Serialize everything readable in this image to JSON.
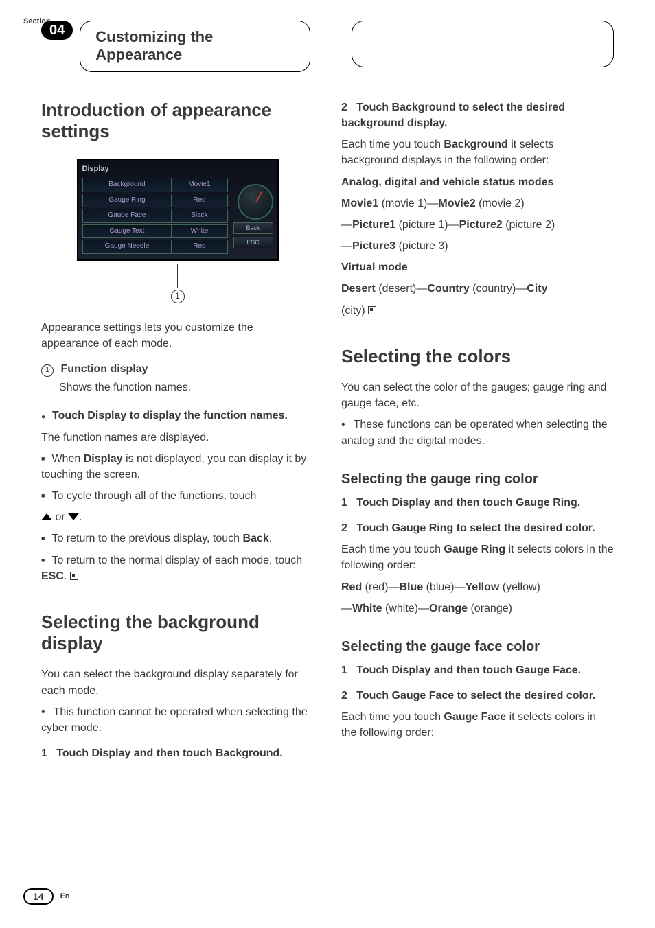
{
  "header": {
    "section_label": "Section",
    "section_number": "04",
    "section_title": "Customizing the Appearance"
  },
  "left_col": {
    "intro": {
      "heading": "Introduction of appearance settings",
      "screenshot": {
        "window_title": "Display",
        "items": [
          {
            "label": "Background",
            "value": "Movie1"
          },
          {
            "label": "Gauge Ring",
            "value": "Red"
          },
          {
            "label": "Gauge Face",
            "value": "Black"
          },
          {
            "label": "Gauge Text",
            "value": "White"
          },
          {
            "label": "Gauge Needle",
            "value": "Red"
          }
        ],
        "side_buttons": [
          "Back",
          "ESC"
        ],
        "callout_number": "1"
      },
      "lead": "Appearance settings lets you customize the appearance of each mode.",
      "func": {
        "num": "1",
        "title": "Function display",
        "desc": "Shows the function names."
      },
      "step_dot": {
        "bold": "Touch Display to display the function names.",
        "plain": "The function names are displayed."
      },
      "notes": {
        "n1a": "When ",
        "n1b": "Display",
        "n1c": " is not displayed, you can display it by touching the screen.",
        "n2": "To cycle through all of the functions, touch",
        "n2b": " or ",
        "n2c": ".",
        "n3a": "To return to the previous display, touch ",
        "n3b": "Back",
        "n3c": ".",
        "n4a": "To return to the normal display of each mode, touch ",
        "n4b": "ESC",
        "n4c": "."
      }
    },
    "bg": {
      "heading": "Selecting the background display",
      "lead": "You can select the background display separately for each mode.",
      "bullet": "This function cannot be operated when selecting the cyber mode.",
      "step1_num": "1",
      "step1": "Touch Display and then touch Background."
    }
  },
  "right_col": {
    "bg2": {
      "step2_num": "2",
      "step2_bold": "Touch Background to select the desired background display.",
      "line1a": "Each time you touch ",
      "line1b": "Background",
      "line1c": " it selects background displays in the following order:",
      "modes_heading": "Analog, digital and vehicle status modes",
      "seq1a": "Movie1",
      "seq1b": " (movie 1)—",
      "seq1c": "Movie2",
      "seq1d": " (movie 2)",
      "seq2a": "—",
      "seq2b": "Picture1",
      "seq2c": " (picture 1)—",
      "seq2d": "Picture2",
      "seq2e": " (picture 2)",
      "seq3a": "—",
      "seq3b": "Picture3",
      "seq3c": " (picture 3)",
      "virtual_heading": "Virtual mode",
      "seq4a": "Desert",
      "seq4b": " (desert)—",
      "seq4c": "Country",
      "seq4d": " (country)—",
      "seq4e": "City",
      "seq5": "(city)"
    },
    "colors": {
      "heading": "Selecting the colors",
      "lead": "You can select the color of the gauges; gauge ring and gauge face, etc.",
      "bullet": "These functions can be operated when selecting the analog and the digital modes."
    },
    "ring": {
      "heading": "Selecting the gauge ring color",
      "step1_num": "1",
      "step1": "Touch Display and then touch Gauge Ring.",
      "step2_num": "2",
      "step2": "Touch Gauge Ring to select the desired color.",
      "line_a": "Each time you touch ",
      "line_b": "Gauge Ring",
      "line_c": " it selects colors in the following order:",
      "seq1a": "Red",
      "seq1b": " (red)—",
      "seq1c": "Blue",
      "seq1d": " (blue)—",
      "seq1e": "Yellow",
      "seq1f": " (yellow)",
      "seq2a": "—",
      "seq2b": "White",
      "seq2c": " (white)—",
      "seq2d": "Orange",
      "seq2e": " (orange)"
    },
    "face": {
      "heading": "Selecting the gauge face color",
      "step1_num": "1",
      "step1": "Touch Display and then touch Gauge Face.",
      "step2_num": "2",
      "step2": "Touch Gauge Face to select the desired color.",
      "line_a": "Each time you touch ",
      "line_b": "Gauge Face",
      "line_c": " it selects colors in the following order:"
    }
  },
  "footer": {
    "page": "14",
    "lang": "En"
  }
}
